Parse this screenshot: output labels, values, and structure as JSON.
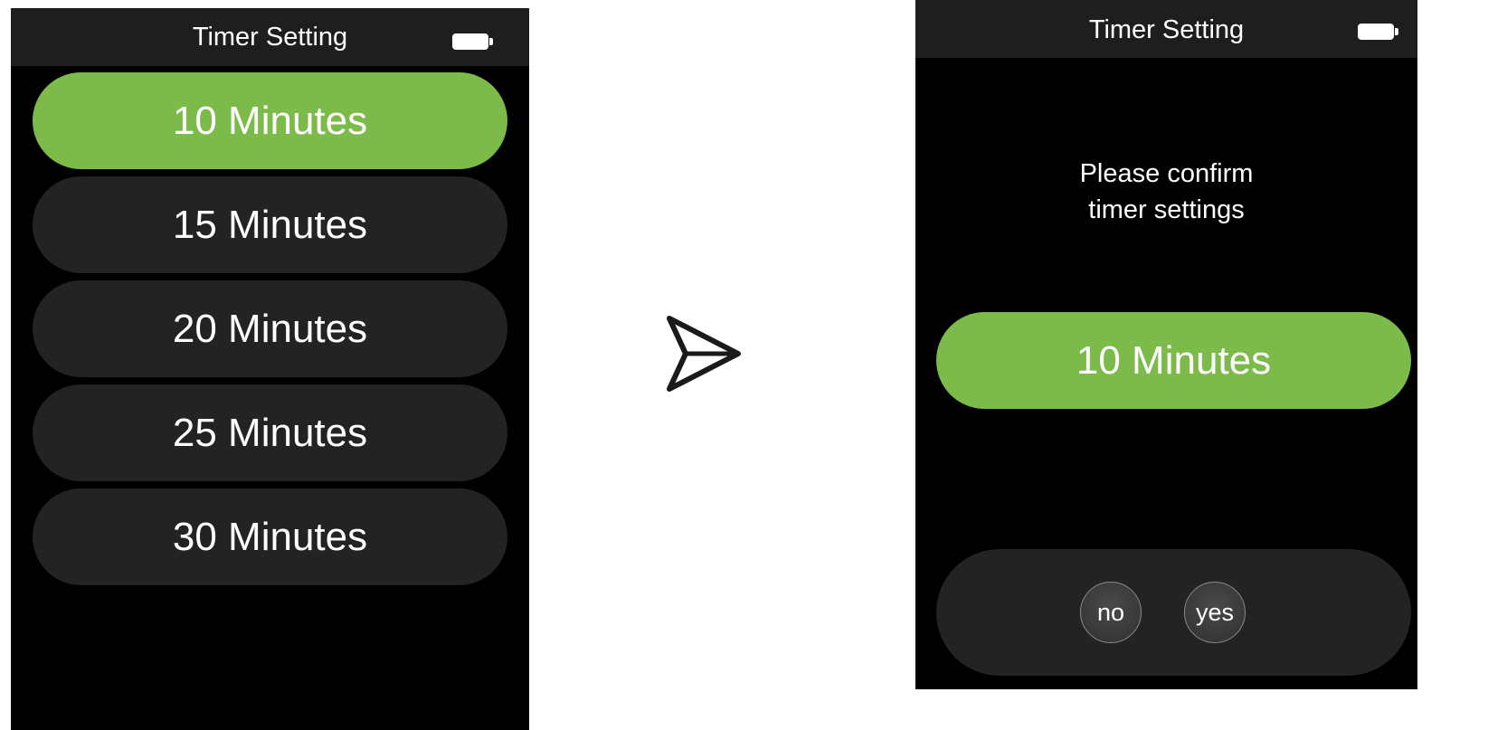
{
  "left_screen": {
    "title": "Timer Setting",
    "battery_icon": "battery-full-icon",
    "options": [
      {
        "label": "10 Minutes",
        "selected": true
      },
      {
        "label": "15 Minutes",
        "selected": false
      },
      {
        "label": "20 Minutes",
        "selected": false
      },
      {
        "label": "25 Minutes",
        "selected": false
      },
      {
        "label": "30 Minutes",
        "selected": false
      }
    ]
  },
  "transition_icon": "arrow-right-icon",
  "right_screen": {
    "title": "Timer Setting",
    "battery_icon": "battery-full-icon",
    "prompt_line1": "Please confirm",
    "prompt_line2": "timer settings",
    "selected_value": "10 Minutes",
    "no_label": "no",
    "yes_label": "yes"
  },
  "colors": {
    "screen_bg": "#000000",
    "header_bg": "#1e1e1e",
    "pill_bg": "#232323",
    "accent_green": "#7cbb4a",
    "text": "#ffffff"
  }
}
